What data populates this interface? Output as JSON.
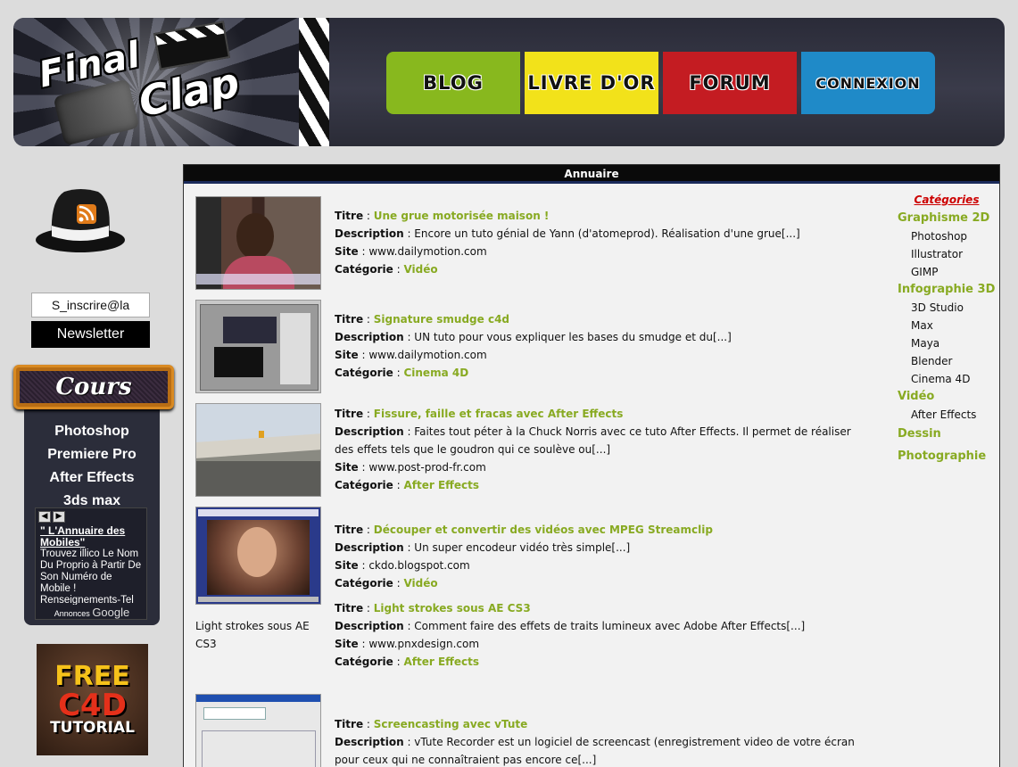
{
  "logo": {
    "line1": "Final",
    "line2": "Clap"
  },
  "nav": [
    {
      "label": "BLOG",
      "color": "#88b81e"
    },
    {
      "label": "LIVRE D'OR",
      "color": "#f2e21a"
    },
    {
      "label": "FORUM",
      "color": "#c41c22"
    },
    {
      "label": "CONNEXION",
      "color": "#1f8ac8"
    }
  ],
  "newsletter": {
    "input_value": "S_inscrire@la",
    "button_label": "Newsletter"
  },
  "cours": {
    "title": "Cours",
    "items": [
      "Photoshop",
      "Premiere Pro",
      "After Effects",
      "3ds max"
    ]
  },
  "ad": {
    "title": "\" L'Annuaire des Mobiles\"",
    "text": "Trouvez illico Le Nom Du Proprio à Partir De Son Numéro de Mobile ! Renseignements-Tel",
    "footer_annonces": "Annonces",
    "footer_google": "Google"
  },
  "freec4d": {
    "line1": "FREE",
    "line2": "C4D",
    "line3": "TUTORIAL"
  },
  "main": {
    "header": "Annuaire",
    "labels": {
      "titre": "Titre",
      "description": "Description",
      "site": "Site",
      "categorie": "Catégorie"
    },
    "entries": [
      {
        "title": "Une grue motorisée maison !",
        "description": "Encore un tuto génial de Yann (d'atomeprod). Réalisation d'une grue[...]",
        "site": "www.dailymotion.com",
        "category": "Vidéo",
        "thumb": "person"
      },
      {
        "title": "Signature smudge c4d",
        "description": "UN tuto pour vous expliquer les bases du smudge et du[...]",
        "site": "www.dailymotion.com",
        "category": "Cinema 4D",
        "thumb": "screen"
      },
      {
        "title": "Fissure, faille et fracas avec After Effects",
        "description": "Faites tout péter à la Chuck Norris avec ce tuto After Effects. Il permet de réaliser des effets tels que le goudron qui ce soulève ou[...]",
        "site": "www.post-prod-fr.com",
        "category": "After Effects",
        "thumb": "road"
      },
      {
        "title": "Découper et convertir des vidéos avec MPEG Streamclip",
        "description": "Un super encodeur vidéo très simple[...]",
        "site": "ckdo.blogspot.com",
        "category": "Vidéo",
        "thumb": "portrait"
      },
      {
        "title": "Light strokes sous AE CS3",
        "description": "Comment faire des effets de traits lumineux avec Adobe After Effects[...]",
        "site": "www.pnxdesign.com",
        "category": "After Effects",
        "thumb": "none",
        "alt": "Light strokes sous AE CS3"
      },
      {
        "title": "Screencasting avec vTute",
        "description": "vTute Recorder est un logiciel de screencast (enregistrement video de votre écran pour ceux qui ne connaîtraient pas encore ce[...]",
        "site": "",
        "category": "",
        "thumb": "vtute"
      }
    ]
  },
  "categories": {
    "title": "Catégories",
    "groups": [
      {
        "name": "Graphisme 2D",
        "subs": [
          "Photoshop",
          "Illustrator",
          "GIMP"
        ]
      },
      {
        "name": "Infographie 3D",
        "subs": [
          "3D Studio",
          "Max",
          "Maya",
          "Blender",
          "Cinema 4D"
        ]
      },
      {
        "name": "Vidéo",
        "subs": [
          "After Effects"
        ]
      },
      {
        "name": "Dessin",
        "subs": []
      },
      {
        "name": "Photographie",
        "subs": []
      }
    ]
  }
}
